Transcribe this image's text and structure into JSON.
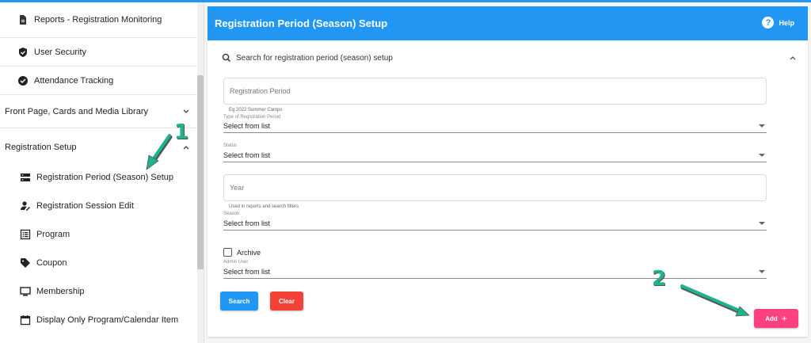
{
  "colors": {
    "primary": "#2196f3",
    "danger": "#f44336",
    "accent": "#ff4081",
    "annotation": "#1db38f"
  },
  "sidebar": {
    "items": [
      {
        "label": "Reports - Registration Monitoring",
        "icon": "document-icon"
      },
      {
        "label": "User Security",
        "icon": "shield-icon"
      },
      {
        "label": "Attendance Tracking",
        "icon": "check-circle-icon"
      },
      {
        "label": "Front Page, Cards and Media Library",
        "icon": "chevron-down-icon"
      },
      {
        "label": "Registration Setup",
        "icon": "chevron-up-icon"
      },
      {
        "label": "Registration Period (Season) Setup",
        "icon": "storage-icon"
      },
      {
        "label": "Registration Session Edit",
        "icon": "person-edit-icon"
      },
      {
        "label": "Program",
        "icon": "list-icon"
      },
      {
        "label": "Coupon",
        "icon": "tag-icon"
      },
      {
        "label": "Membership",
        "icon": "monitor-icon"
      },
      {
        "label": "Display Only Program/Calendar Item",
        "icon": "calendar-icon"
      }
    ]
  },
  "header": {
    "title": "Registration Period (Season) Setup",
    "help_label": "Help",
    "help_icon_text": "?"
  },
  "search_panel": {
    "title": "Search for registration period (season) setup",
    "registration_period": {
      "placeholder": "Registration Period",
      "hint": "Eg 2022 Summer Camps"
    },
    "type_of_period": {
      "label": "Type of Registration Period",
      "value": "Select from list"
    },
    "status": {
      "label": "Status",
      "value": "Select from list"
    },
    "year": {
      "placeholder": "Year",
      "hint": "Used in reports and search filters"
    },
    "season": {
      "label": "Season",
      "value": "Select from list"
    },
    "archive_label": "Archive",
    "admin_user": {
      "label": "Admin User",
      "value": "Select from list"
    },
    "search_button": "Search",
    "clear_button": "Clear"
  },
  "add_button": {
    "label": "Add",
    "icon_text": "+"
  },
  "annotations": {
    "first": "1",
    "second": "2"
  }
}
